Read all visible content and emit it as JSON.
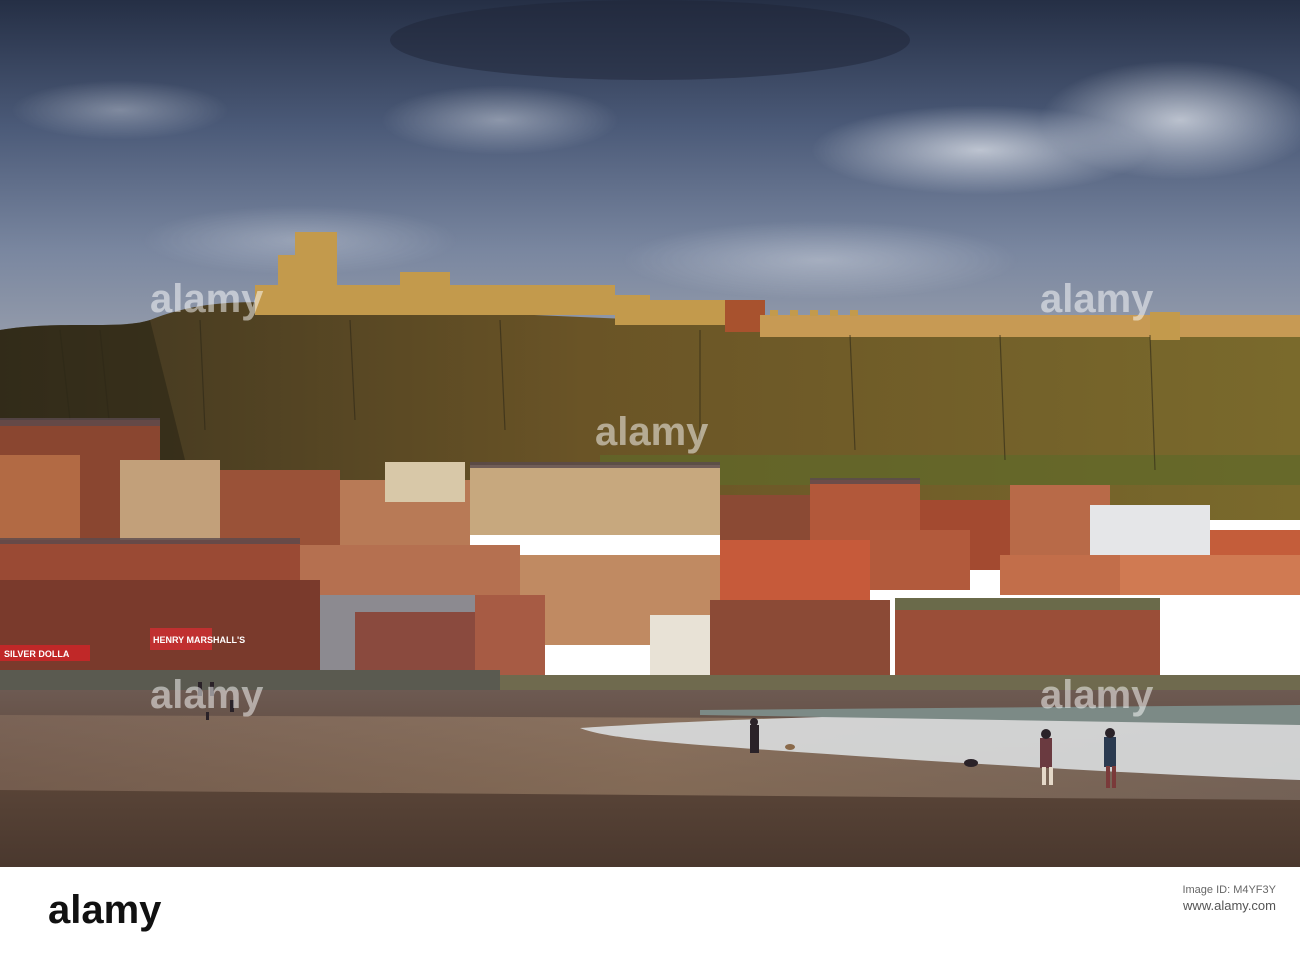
{
  "photo": {
    "subject": "Scarborough Castle on the headland above the South Bay town and beach at sunset",
    "shop_signs": [
      "HENRY MARSHALL'S",
      "SILVER DOLLA"
    ]
  },
  "watermark": {
    "text": "alamy"
  },
  "footer": {
    "logo": "alamy",
    "image_id_label": "Image ID: M4YF3Y",
    "url": "www.alamy.com",
    "image_id": "M4YF3Y"
  },
  "colors": {
    "sky_dark": "#2e3a52",
    "sky_mid": "#6d7f9c",
    "hill": "#6b5424",
    "castle": "#c9a050",
    "sand": "#5e4a40",
    "sea_foam": "#dfe4e6"
  }
}
